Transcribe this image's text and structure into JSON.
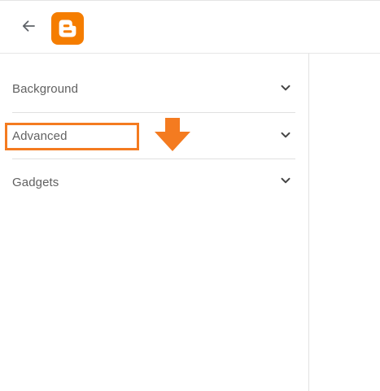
{
  "header": {
    "back_icon": "arrow-left-icon",
    "logo_icon": "blogger-logo-icon",
    "logo_color": "#f57d00"
  },
  "sidebar": {
    "sections": [
      {
        "label": "Background",
        "icon": "chevron-down-icon"
      },
      {
        "label": "Advanced",
        "icon": "chevron-down-icon"
      },
      {
        "label": "Gadgets",
        "icon": "chevron-down-icon"
      }
    ]
  },
  "annotations": {
    "highlight_color": "#f47b20",
    "arrow_icon": "arrow-down-icon"
  }
}
